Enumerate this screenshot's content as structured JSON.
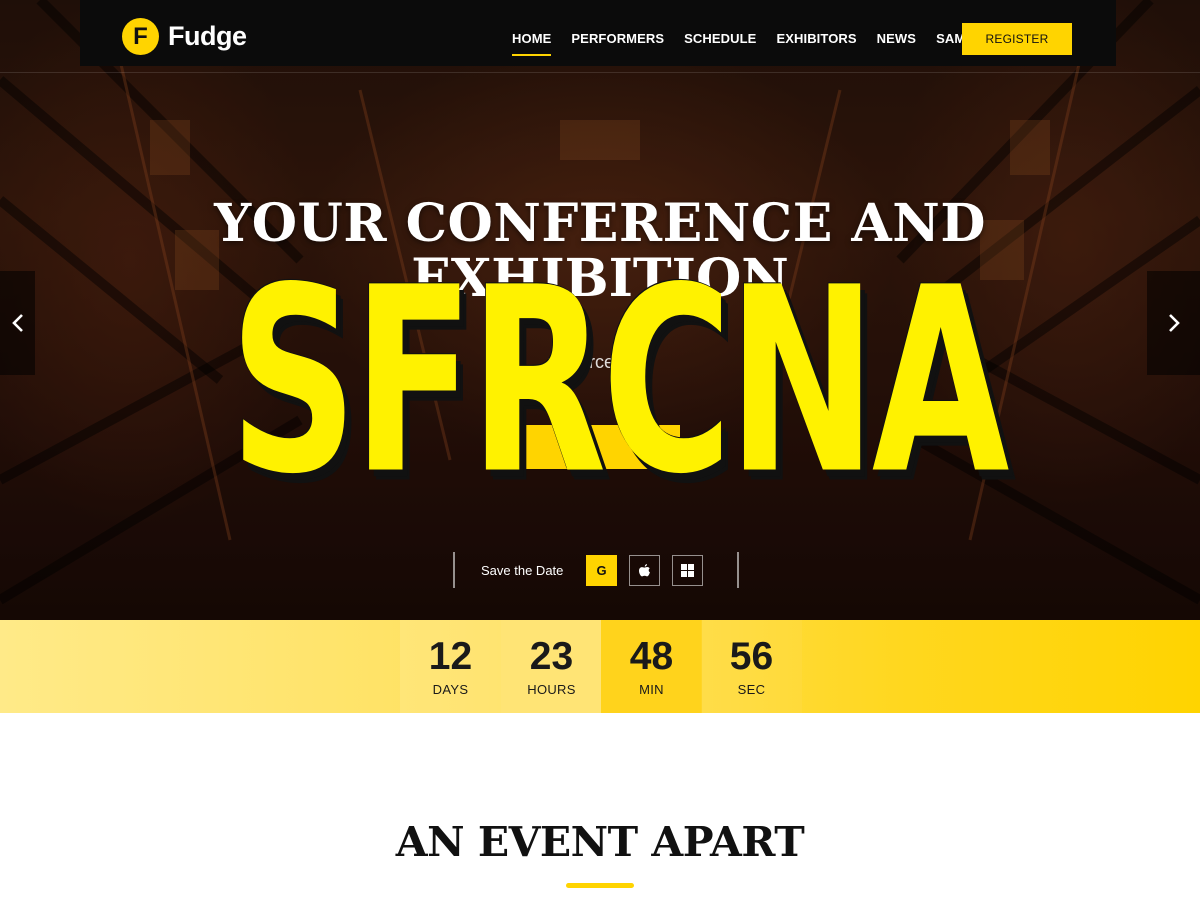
{
  "brand": {
    "logo_letter": "F",
    "name": "Fudge"
  },
  "nav": {
    "items": [
      {
        "label": "HOME",
        "active": true
      },
      {
        "label": "PERFORMERS",
        "active": false
      },
      {
        "label": "SCHEDULE",
        "active": false
      },
      {
        "label": "EXHIBITORS",
        "active": false
      },
      {
        "label": "NEWS",
        "active": false
      },
      {
        "label": "SAMPLE",
        "active": false
      }
    ],
    "register_label": "REGISTER"
  },
  "hero": {
    "title": "YOUR CONFERENCE AND",
    "title_partial": "EXHIBITION",
    "subtitle_partial": "m              Barcelona,",
    "overlay_stamp": "SFRCNA",
    "save_the_date_label": "Save the Date",
    "calendar_buttons": [
      {
        "icon": "google-icon",
        "glyph": "G"
      },
      {
        "icon": "apple-icon",
        "glyph": ""
      },
      {
        "icon": "windows-icon",
        "glyph": ""
      }
    ]
  },
  "countdown": [
    {
      "value": "12",
      "label": "DAYS"
    },
    {
      "value": "23",
      "label": "HOURS"
    },
    {
      "value": "48",
      "label": "MIN"
    },
    {
      "value": "56",
      "label": "SEC"
    }
  ],
  "section": {
    "title": "AN EVENT APART"
  },
  "colors": {
    "accent": "#ffd400",
    "nav_bg": "#0b0b0b",
    "text_dark": "#111111"
  }
}
